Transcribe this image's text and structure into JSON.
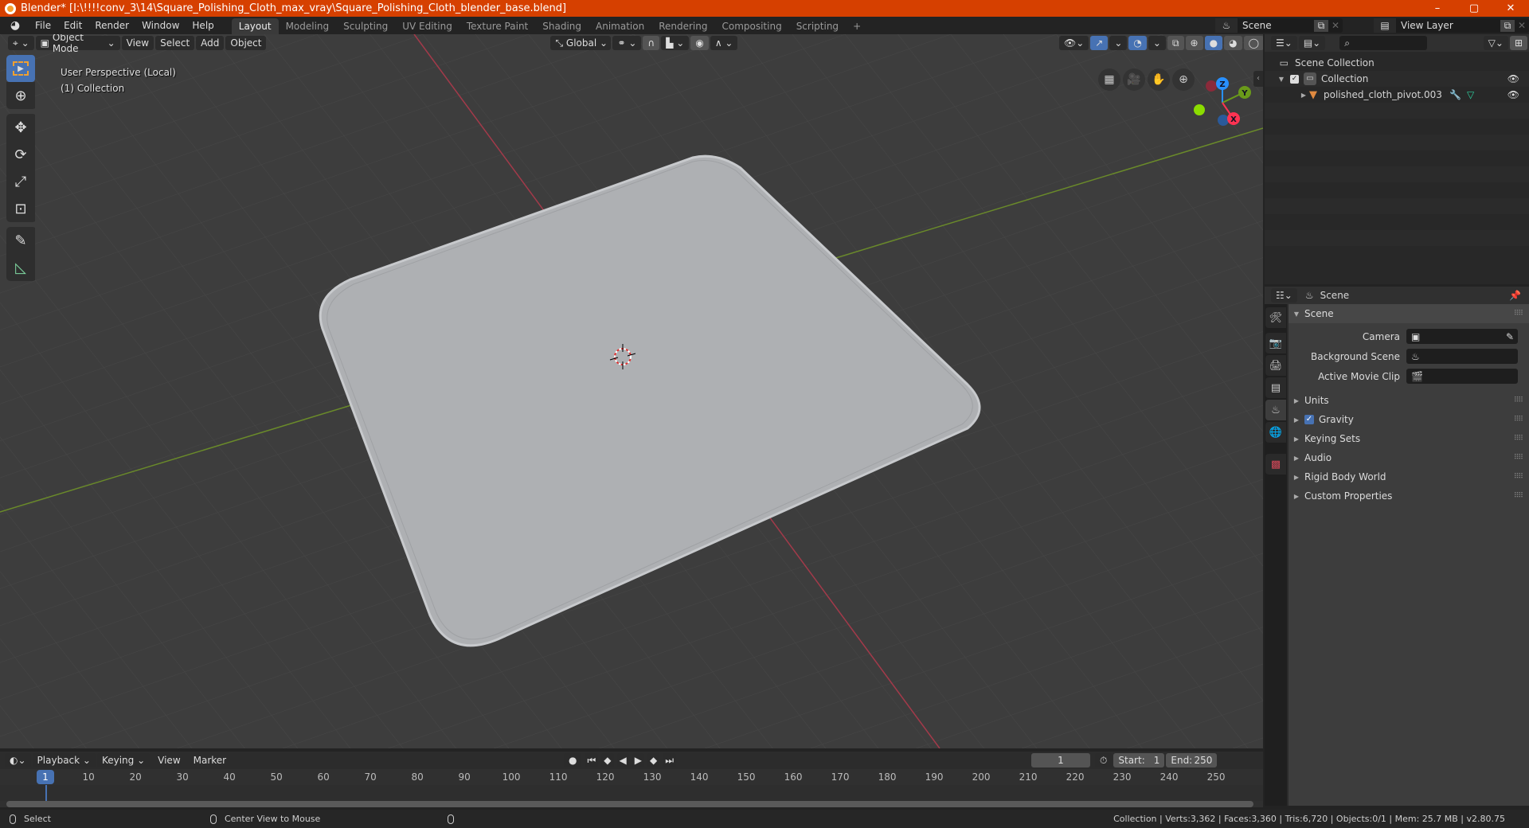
{
  "window": {
    "title": "Blender* [I:\\!!!!conv_3\\14\\Square_Polishing_Cloth_max_vray\\Square_Polishing_Cloth_blender_base.blend]",
    "controls": [
      "–",
      "▢",
      "✕"
    ]
  },
  "topbar": {
    "menus": [
      "File",
      "Edit",
      "Render",
      "Window",
      "Help"
    ],
    "workspaces": [
      "Layout",
      "Modeling",
      "Sculpting",
      "UV Editing",
      "Texture Paint",
      "Shading",
      "Animation",
      "Rendering",
      "Compositing",
      "Scripting"
    ],
    "active_workspace": "Layout",
    "add_workspace": "+",
    "scene": "Scene",
    "view_layer": "View Layer"
  },
  "viewport": {
    "mode": "Object Mode",
    "menus": [
      "View",
      "Select",
      "Add",
      "Object"
    ],
    "orientation": "Global",
    "overlay_text": {
      "perspective": "User Perspective (Local)",
      "collection": "(1) Collection"
    },
    "gizmo_axes": {
      "x": "X",
      "y": "Y",
      "z": "Z"
    },
    "colors": {
      "x_axis": "#ff3352",
      "y_axis": "#8bdc00",
      "z_axis": "#2890ff",
      "object": "#aeb0b3",
      "grid_bg": "#3d3d3d"
    }
  },
  "outliner": {
    "search_placeholder": "",
    "items": [
      {
        "label": "Scene Collection",
        "level": 0
      },
      {
        "label": "Collection",
        "level": 1,
        "checked": true,
        "visible": true
      },
      {
        "label": "polished_cloth_pivot.003",
        "level": 2,
        "visible": true
      }
    ]
  },
  "properties": {
    "context": "Scene",
    "panel": "Scene",
    "fields": [
      {
        "label": "Camera",
        "value": ""
      },
      {
        "label": "Background Scene",
        "value": ""
      },
      {
        "label": "Active Movie Clip",
        "value": ""
      }
    ],
    "subpanels": [
      {
        "label": "Units"
      },
      {
        "label": "Gravity",
        "checkbox": true
      },
      {
        "label": "Keying Sets"
      },
      {
        "label": "Audio"
      },
      {
        "label": "Rigid Body World"
      },
      {
        "label": "Custom Properties"
      }
    ],
    "accent": "#4772b3"
  },
  "timeline": {
    "menus": [
      "Playback",
      "Keying",
      "View",
      "Marker"
    ],
    "current_frame": "1",
    "start_label": "Start:",
    "start": "1",
    "end_label": "End:",
    "end": "250",
    "ticks": [
      "10",
      "20",
      "30",
      "40",
      "50",
      "60",
      "70",
      "80",
      "90",
      "100",
      "110",
      "120",
      "130",
      "140",
      "150",
      "160",
      "170",
      "180",
      "190",
      "200",
      "210",
      "220",
      "230",
      "240",
      "250"
    ],
    "playhead": "1"
  },
  "statusbar": {
    "left_action": "Select",
    "middle_action": "Center View to Mouse",
    "stats": "Collection | Verts:3,362 | Faces:3,360 | Tris:6,720 | Objects:0/1 | Mem: 25.7 MB | v2.80.75"
  }
}
